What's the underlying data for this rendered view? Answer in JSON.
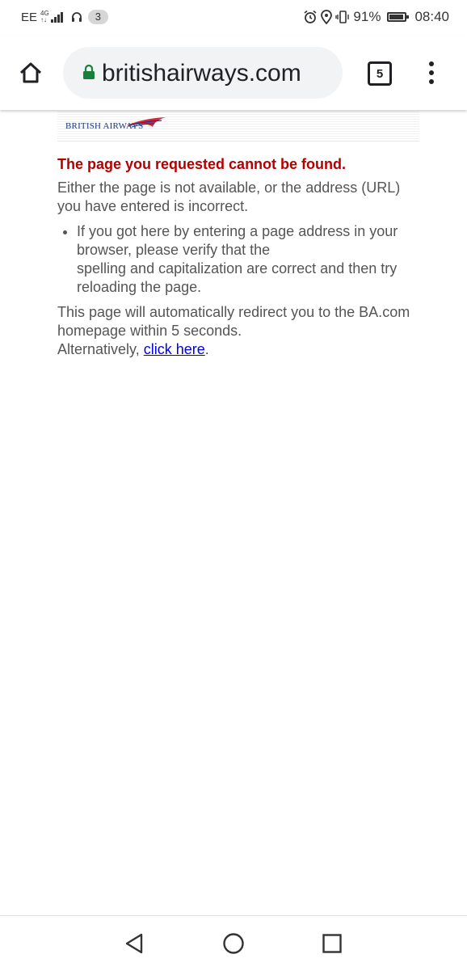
{
  "status_bar": {
    "carrier": "EE",
    "network_top": "4G",
    "network_bottom": "↑↓",
    "notification_count": "3",
    "battery_percent": "91%",
    "battery_level": 0.91,
    "time": "08:40",
    "icons": [
      "headset-icon",
      "alarm-icon",
      "location-icon",
      "vibrate-icon",
      "battery-icon",
      "signal-icon"
    ]
  },
  "browser": {
    "url_display": "britishairways.com",
    "tab_count": "5",
    "secure": true,
    "lock_color": "#188038",
    "icons": [
      "home-icon",
      "lock-icon",
      "tab-switcher-icon",
      "overflow-menu-icon"
    ]
  },
  "page": {
    "logo_text": "BRITISH AIRWAYS",
    "error_title": "The page you requested cannot be found.",
    "explanation": "Either the page is not available, or the address (URL) you have entered is incorrect.",
    "bullets": [
      {
        "line1": "If you got here by entering a page address in your browser, please verify that the",
        "line2": "spelling and capitalization are correct and then try reloading the page."
      }
    ],
    "redirect_text": "This page will automatically redirect you to the BA.com homepage within 5 seconds.",
    "alternative_prefix": "Alternatively,",
    "link_text": "click here",
    "alternative_suffix": ".",
    "colors": {
      "error_title": "#b30000",
      "body_text": "#555555",
      "link": "#0000ee",
      "logo_blue": "#1b3a7a",
      "logo_red": "#d6253a"
    }
  },
  "navbar": {
    "icons": [
      "back-icon",
      "home-circle-icon",
      "recents-icon"
    ]
  }
}
